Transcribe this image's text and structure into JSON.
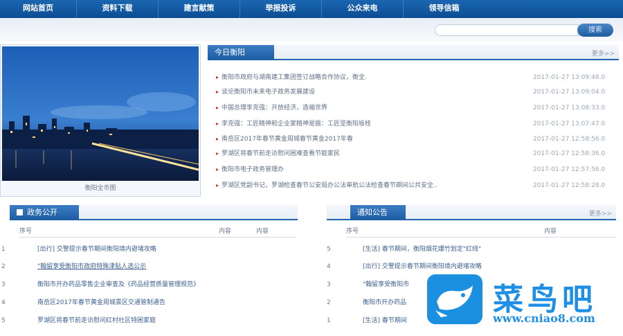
{
  "nav": {
    "items": [
      {
        "label": "网站首页"
      },
      {
        "label": "资料下载"
      },
      {
        "label": "建言献策"
      },
      {
        "label": "举报投诉"
      },
      {
        "label": "公众来电"
      },
      {
        "label": "领导信箱"
      }
    ]
  },
  "search": {
    "button_label": "搜索",
    "placeholder": ""
  },
  "hero": {
    "caption": "衡阳全市图"
  },
  "today": {
    "tab": "今日衡阳",
    "more": "更多>>",
    "items": [
      {
        "title": "衡阳市政府与湖南建工集团签订战略合作协议，衡全.",
        "date": "2017-01-27 13:09:48.0"
      },
      {
        "title": "谈论衡阳市未来电子政务发展建设",
        "date": "2017-01-27 13:09:04.0"
      },
      {
        "title": "中国总理李克强：开放经济，造福世界",
        "date": "2017-01-27 13:08:33.0"
      },
      {
        "title": "李克强：工匠精神和企业家精神是振：工匠坚衡阳坂桂",
        "date": "2017-01-27 13:07:47.0"
      },
      {
        "title": "南岳区2017年春节黄金周城春节黄金2017年春",
        "date": "2017-01-27 12:58:56.0"
      },
      {
        "title": "罗湖区将春节前走访慰问困难查看节能家民",
        "date": "2017-01-27 12:58:36.0"
      },
      {
        "title": "衡阳市电子政务管理办",
        "date": "2017-01-27 12:57:56.0"
      },
      {
        "title": "罗湖区党副书记，罗湖检查春节公安局办公法审航公法检查春节期间公共安全..",
        "date": "2017-01-27 12:58:28.0"
      }
    ]
  },
  "gov": {
    "tab": "政务公开",
    "col_idx": "序号",
    "col_content1": "内容",
    "col_content2": "内容",
    "rows": [
      {
        "idx": "1",
        "text": "[出行] 交警提示春节期间衡阳境内避堵攻略"
      },
      {
        "idx": "2",
        "text": "\"翰留享受衡阳市政府特殊津贴人选公示"
      },
      {
        "idx": "3",
        "text": "衡阳市开办药品零售企业审查及《药品经营质量管理规范》"
      },
      {
        "idx": "4",
        "text": "南岳区2017年春节黄金周城景区交通管制通告"
      },
      {
        "idx": "5",
        "text": "罗湖区将春节前走访慰问红村社区特困家庭"
      }
    ]
  },
  "notice": {
    "tab": "通知公告",
    "more": "更多>>",
    "col_idx": "序号",
    "col_content": "内容",
    "rows": [
      {
        "idx": "5",
        "text": "[生活] 春节期间，衡阳烟花爆竹划定\"红线\""
      },
      {
        "idx": "4",
        "text": "[出行] 交警提示春节期间衡阳境内避堵攻略"
      },
      {
        "idx": "3",
        "text": "\"翰留享受衡阳市"
      },
      {
        "idx": "2",
        "text": "衡阳市开办药品"
      },
      {
        "idx": "1",
        "text": "[生活] 春节期间"
      }
    ]
  },
  "watermark": {
    "name": "菜鸟吧",
    "url": "www.cniao8.com"
  },
  "colors": {
    "nav": "#0c4d94",
    "accent": "#1f62ad",
    "logo": "#1f8fe6"
  }
}
